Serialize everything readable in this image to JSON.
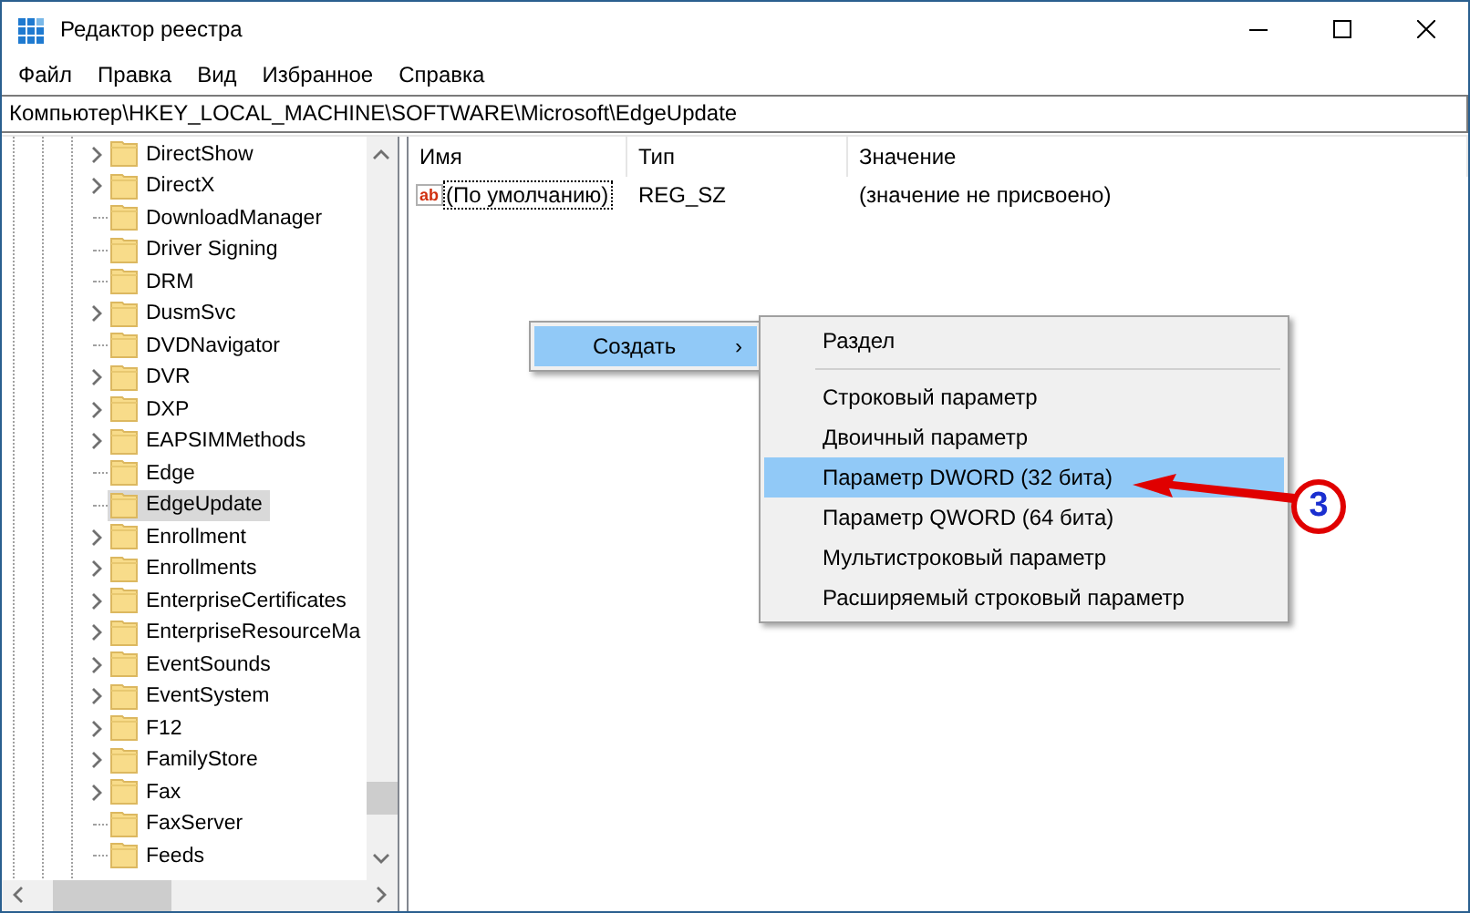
{
  "window": {
    "title": "Редактор реестра"
  },
  "menu": [
    "Файл",
    "Правка",
    "Вид",
    "Избранное",
    "Справка"
  ],
  "address": "Компьютер\\HKEY_LOCAL_MACHINE\\SOFTWARE\\Microsoft\\EdgeUpdate",
  "tree": [
    {
      "label": "DirectShow",
      "expandable": true,
      "selected": false
    },
    {
      "label": "DirectX",
      "expandable": true,
      "selected": false
    },
    {
      "label": "DownloadManager",
      "expandable": false,
      "selected": false
    },
    {
      "label": "Driver Signing",
      "expandable": false,
      "selected": false
    },
    {
      "label": "DRM",
      "expandable": false,
      "selected": false
    },
    {
      "label": "DusmSvc",
      "expandable": true,
      "selected": false
    },
    {
      "label": "DVDNavigator",
      "expandable": false,
      "selected": false
    },
    {
      "label": "DVR",
      "expandable": true,
      "selected": false
    },
    {
      "label": "DXP",
      "expandable": true,
      "selected": false
    },
    {
      "label": "EAPSIMMethods",
      "expandable": true,
      "selected": false
    },
    {
      "label": "Edge",
      "expandable": false,
      "selected": false
    },
    {
      "label": "EdgeUpdate",
      "expandable": false,
      "selected": true
    },
    {
      "label": "Enrollment",
      "expandable": true,
      "selected": false
    },
    {
      "label": "Enrollments",
      "expandable": true,
      "selected": false
    },
    {
      "label": "EnterpriseCertificates",
      "expandable": true,
      "selected": false
    },
    {
      "label": "EnterpriseResourceMa",
      "expandable": true,
      "selected": false
    },
    {
      "label": "EventSounds",
      "expandable": true,
      "selected": false
    },
    {
      "label": "EventSystem",
      "expandable": true,
      "selected": false
    },
    {
      "label": "F12",
      "expandable": true,
      "selected": false
    },
    {
      "label": "FamilyStore",
      "expandable": true,
      "selected": false
    },
    {
      "label": "Fax",
      "expandable": true,
      "selected": false
    },
    {
      "label": "FaxServer",
      "expandable": false,
      "selected": false
    },
    {
      "label": "Feeds",
      "expandable": false,
      "selected": false
    }
  ],
  "table": {
    "columns": [
      "Имя",
      "Тип",
      "Значение"
    ],
    "rows": [
      {
        "icon_text": "ab",
        "name": "(По умолчанию)",
        "type": "REG_SZ",
        "value": "(значение не присвоено)",
        "focused": true
      }
    ]
  },
  "context_menu": [
    {
      "label": "Создать",
      "arrow": "›",
      "selected": true
    }
  ],
  "submenu": [
    {
      "kind": "item",
      "label": "Раздел",
      "selected": false
    },
    {
      "kind": "separator"
    },
    {
      "kind": "item",
      "label": "Строковый параметр",
      "selected": false
    },
    {
      "kind": "item",
      "label": "Двоичный параметр",
      "selected": false
    },
    {
      "kind": "item",
      "label": "Параметр DWORD (32 бита)",
      "selected": true
    },
    {
      "kind": "item",
      "label": "Параметр QWORD (64 бита)",
      "selected": false
    },
    {
      "kind": "item",
      "label": "Мультистроковый параметр",
      "selected": false
    },
    {
      "kind": "item",
      "label": "Расширяемый строковый параметр",
      "selected": false
    }
  ],
  "annotation": {
    "label": "3"
  }
}
